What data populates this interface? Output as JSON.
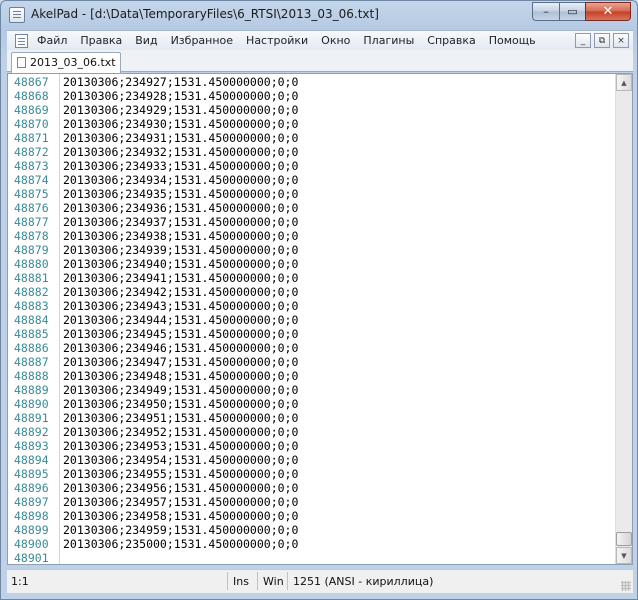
{
  "window": {
    "title": "AkelPad - [d:\\Data\\TemporaryFiles\\6_RTSI\\2013_03_06.txt]",
    "controls": {
      "minimize": "–",
      "maximize": "▭",
      "close": "✕"
    }
  },
  "menu": {
    "items": [
      "Файл",
      "Правка",
      "Вид",
      "Избранное",
      "Настройки",
      "Окно",
      "Плагины",
      "Справка",
      "Помощь"
    ],
    "mdi_controls": [
      "_",
      "⧉",
      "×"
    ]
  },
  "tabs": [
    {
      "label": "2013_03_06.txt",
      "active": true
    }
  ],
  "editor": {
    "line_numbers": [
      "48867",
      "48868",
      "48869",
      "48870",
      "48871",
      "48872",
      "48873",
      "48874",
      "48875",
      "48876",
      "48877",
      "48878",
      "48879",
      "48880",
      "48881",
      "48882",
      "48883",
      "48884",
      "48885",
      "48886",
      "48887",
      "48888",
      "48889",
      "48890",
      "48891",
      "48892",
      "48893",
      "48894",
      "48895",
      "48896",
      "48897",
      "48898",
      "48899",
      "48900",
      "48901"
    ],
    "lines": [
      "20130306;234927;1531.450000000;0;0",
      "20130306;234928;1531.450000000;0;0",
      "20130306;234929;1531.450000000;0;0",
      "20130306;234930;1531.450000000;0;0",
      "20130306;234931;1531.450000000;0;0",
      "20130306;234932;1531.450000000;0;0",
      "20130306;234933;1531.450000000;0;0",
      "20130306;234934;1531.450000000;0;0",
      "20130306;234935;1531.450000000;0;0",
      "20130306;234936;1531.450000000;0;0",
      "20130306;234937;1531.450000000;0;0",
      "20130306;234938;1531.450000000;0;0",
      "20130306;234939;1531.450000000;0;0",
      "20130306;234940;1531.450000000;0;0",
      "20130306;234941;1531.450000000;0;0",
      "20130306;234942;1531.450000000;0;0",
      "20130306;234943;1531.450000000;0;0",
      "20130306;234944;1531.450000000;0;0",
      "20130306;234945;1531.450000000;0;0",
      "20130306;234946;1531.450000000;0;0",
      "20130306;234947;1531.450000000;0;0",
      "20130306;234948;1531.450000000;0;0",
      "20130306;234949;1531.450000000;0;0",
      "20130306;234950;1531.450000000;0;0",
      "20130306;234951;1531.450000000;0;0",
      "20130306;234952;1531.450000000;0;0",
      "20130306;234953;1531.450000000;0;0",
      "20130306;234954;1531.450000000;0;0",
      "20130306;234955;1531.450000000;0;0",
      "20130306;234956;1531.450000000;0;0",
      "20130306;234957;1531.450000000;0;0",
      "20130306;234958;1531.450000000;0;0",
      "20130306;234959;1531.450000000;0;0",
      "20130306;235000;1531.450000000;0;0",
      ""
    ],
    "scrollbar": {
      "up": "▲",
      "down": "▼"
    }
  },
  "statusbar": {
    "position": "1:1",
    "insert_mode": "Ins",
    "line_ending": "Win",
    "codepage": "1251  (ANSI - кириллица)"
  },
  "colors": {
    "line_number": "#3c8a95",
    "title_bar": "#b4c9e2",
    "close_button": "#c33f24"
  }
}
